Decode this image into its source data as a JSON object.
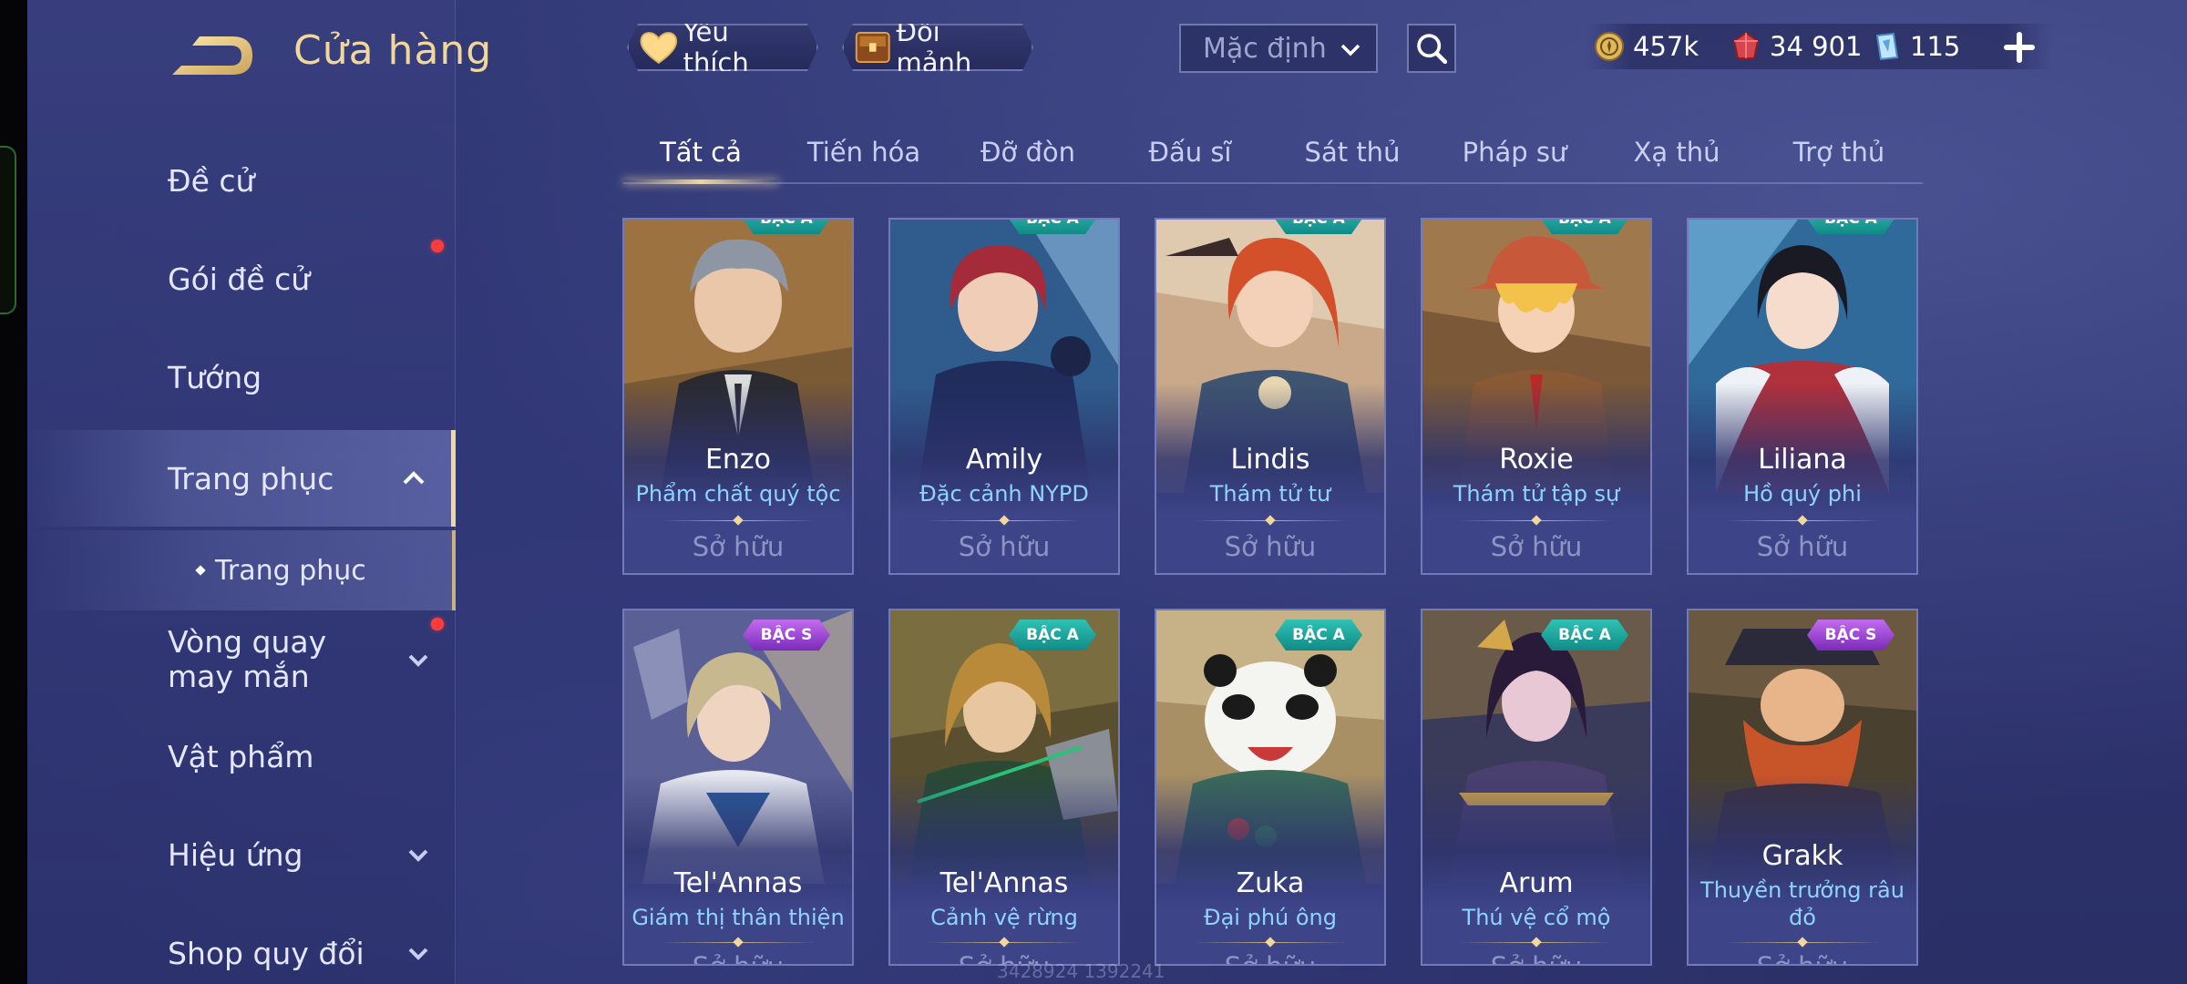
{
  "header": {
    "title": "Cửa hàng",
    "favorites_label": "Yêu thích",
    "exchange_label": "Đổi mảnh",
    "sort_value": "Mặc định"
  },
  "currency": {
    "gold": "457k",
    "vouchers": "34 901",
    "crystals": "115"
  },
  "sidebar": {
    "items": [
      {
        "label": "Đề cử"
      },
      {
        "label": "Gói đề cử"
      },
      {
        "label": "Tướng"
      },
      {
        "label": "Trang phục"
      },
      {
        "label": "Trang phục"
      },
      {
        "label": "Vòng quay may mắn"
      },
      {
        "label": "Vật phẩm"
      },
      {
        "label": "Hiệu ứng"
      },
      {
        "label": "Shop quy đổi"
      }
    ]
  },
  "tabs": [
    {
      "label": "Tất cả"
    },
    {
      "label": "Tiến hóa"
    },
    {
      "label": "Đỡ đòn"
    },
    {
      "label": "Đấu sĩ"
    },
    {
      "label": "Sát thủ"
    },
    {
      "label": "Pháp sư"
    },
    {
      "label": "Xạ thủ"
    },
    {
      "label": "Trợ thủ"
    }
  ],
  "cards": [
    {
      "hero": "Enzo",
      "skin": "Phẩm chất quý tộc",
      "status": "Sở hữu",
      "rank": "BẬC A"
    },
    {
      "hero": "Amily",
      "skin": "Đặc cảnh NYPD",
      "status": "Sở hữu",
      "rank": "BẬC A"
    },
    {
      "hero": "Lindis",
      "skin": "Thám tử tư",
      "status": "Sở hữu",
      "rank": "BẬC A"
    },
    {
      "hero": "Roxie",
      "skin": "Thám tử tập sự",
      "status": "Sở hữu",
      "rank": "BẬC A"
    },
    {
      "hero": "Liliana",
      "skin": "Hồ quý phi",
      "status": "Sở hữu",
      "rank": "BẬC A"
    },
    {
      "hero": "Tel'Annas",
      "skin": "Giám thị thân thiện",
      "status": "Sở hữu",
      "rank": "BẬC S"
    },
    {
      "hero": "Tel'Annas",
      "skin": "Cảnh vệ rừng",
      "status": "Sở hữu",
      "rank": "BẬC A"
    },
    {
      "hero": "Zuka",
      "skin": "Đại phú ông",
      "status": "Sở hữu",
      "rank": "BẬC A"
    },
    {
      "hero": "Arum",
      "skin": "Thú vệ cổ mộ",
      "status": "Sở hữu",
      "rank": "BẬC A"
    },
    {
      "hero": "Grakk",
      "skin": "Thuyền trưởng râu đỏ",
      "status": "Sở hữu",
      "rank": "BẬC S"
    }
  ],
  "watermark": "3428924 1392241",
  "colors": {
    "accent_gold": "#f1d79b",
    "skin_name": "#8fd4ff",
    "rank_a": "#2fc2b5",
    "rank_s": "#c36bf0",
    "notification": "#ff3b3b"
  }
}
